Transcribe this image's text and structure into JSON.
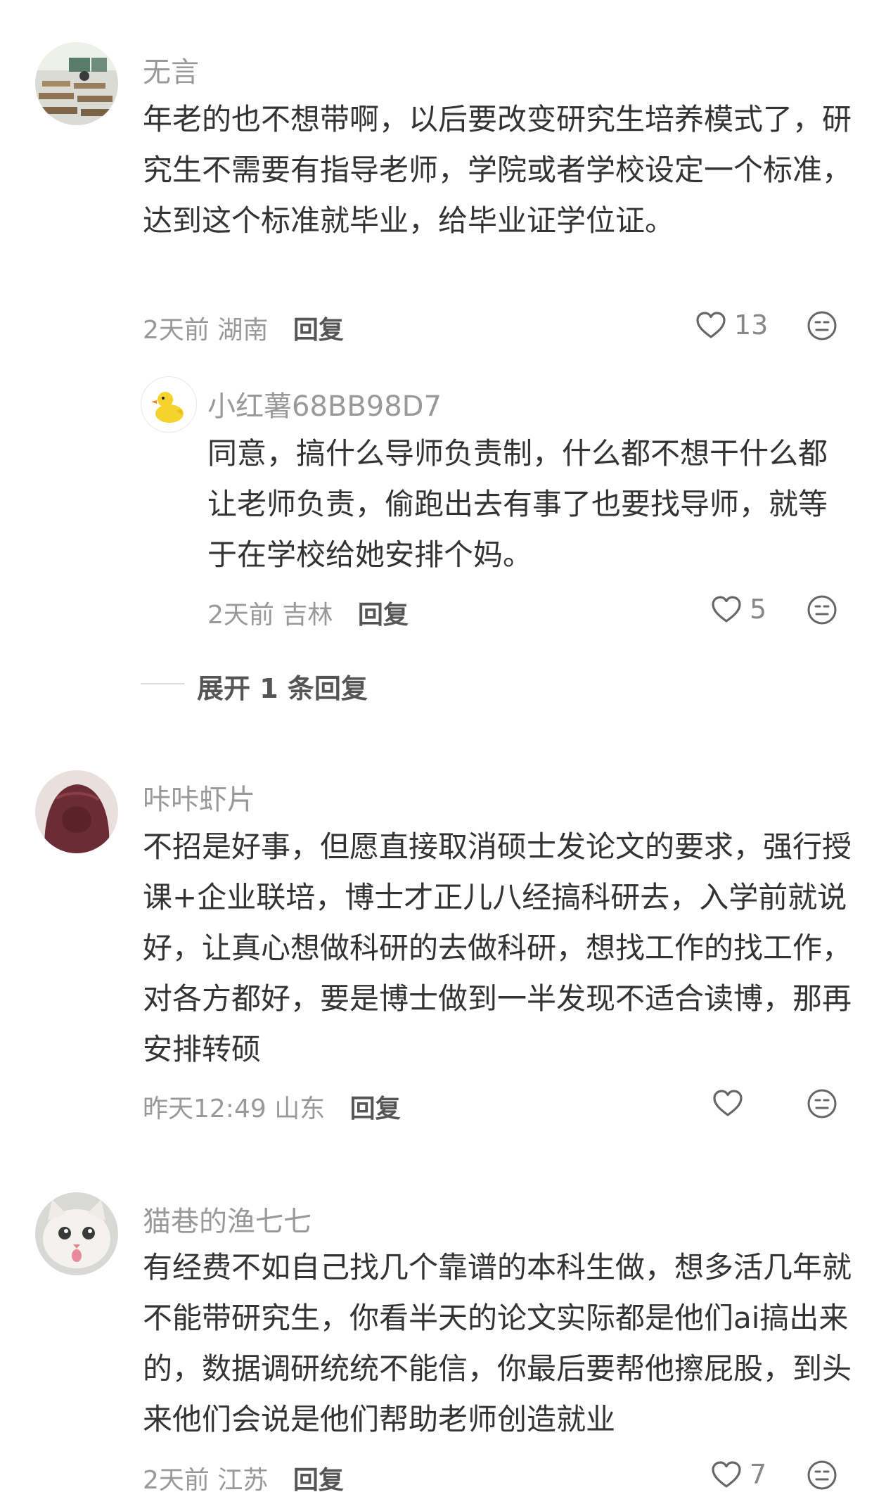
{
  "comments": [
    {
      "username": "无言",
      "content": "年老的也不想带啊，以后要改变研究生培养模式了，研究生不需要有指导老师，学院或者学校设定一个标准，达到这个标准就毕业，给毕业证学位证。",
      "time": "2天前",
      "location": "湖南",
      "reply_label": "回复",
      "likes": "13",
      "reply": {
        "username": "小红薯68BB98D7",
        "content": "同意，搞什么导师负责制，什么都不想干什么都让老师负责，偷跑出去有事了也要找导师，就等于在学校给她安排个妈。",
        "time": "2天前",
        "location": "吉林",
        "reply_label": "回复",
        "likes": "5"
      },
      "expand_label": "展开 1 条回复"
    },
    {
      "username": "咔咔虾片",
      "content": "不招是好事，但愿直接取消硕士发论文的要求，强行授课+企业联培，博士才正儿八经搞科研去，入学前就说好，让真心想做科研的去做科研，想找工作的找工作，对各方都好，要是博士做到一半发现不适合读博，那再安排转硕",
      "time": "昨天12:49",
      "location": "山东",
      "reply_label": "回复",
      "likes": ""
    },
    {
      "username": "猫巷的渔七七",
      "content": "有经费不如自己找几个靠谱的本科生做，想多活几年就不能带研究生，你看半天的论文实际都是他们ai搞出来的，数据调研统统不能信，你最后要帮他擦屁股，到头来他们会说是他们帮助老师创造就业",
      "time": "2天前",
      "location": "江苏",
      "reply_label": "回复",
      "likes": "7"
    }
  ],
  "icons": {
    "heart": "heart-icon",
    "dislike": "dislike-face-icon"
  },
  "colors": {
    "text": "#333333",
    "muted": "#999999",
    "icon": "#666666"
  }
}
